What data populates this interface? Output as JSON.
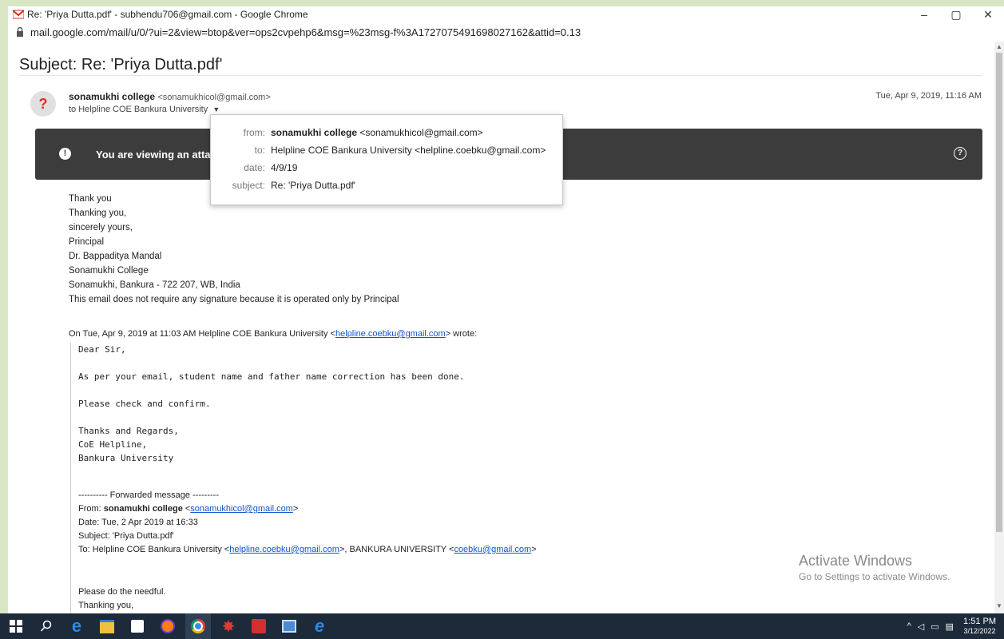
{
  "window": {
    "title": "Re: 'Priya Dutta.pdf' - subhendu706@gmail.com - Google Chrome",
    "controls": {
      "minimize": "–",
      "maximize": "▢",
      "close": "✕"
    }
  },
  "address": {
    "url": "mail.google.com/mail/u/0/?ui=2&view=btop&ver=ops2cvpehp6&msg=%23msg-f%3A1727075491698027162&attid=0.13"
  },
  "email": {
    "subject": "Subject: Re: 'Priya Dutta.pdf'",
    "sender_name": "sonamukhi college",
    "sender_email": "<sonamukhicol@gmail.com>",
    "to_line": "to Helpline COE Bankura University",
    "date": "Tue, Apr 9, 2019, 11:16 AM",
    "banner_text": "You are viewing an attac",
    "popup": {
      "from_label": "from:",
      "from_name": "sonamukhi college",
      "from_email": "<sonamukhicol@gmail.com>",
      "to_label": "to:",
      "to_value": "Helpline COE Bankura University <helpline.coebku@gmail.com>",
      "date_label": "date:",
      "date_value": "4/9/19",
      "subject_label": "subject:",
      "subject_value": "Re: 'Priya Dutta.pdf'"
    },
    "body_lines": [
      "Thank you",
      "Thanking you,",
      "sincerely yours,",
      "Principal",
      "Dr. Bappaditya Mandal",
      "Sonamukhi College",
      "Sonamukhi, Bankura - 722 207, WB, India",
      "This email does not require any signature because it is operated only by Principal"
    ],
    "quote_intro": "On Tue, Apr 9, 2019 at 11:03 AM Helpline COE Bankura University <",
    "quote_link": "helpline.coebku@gmail.com",
    "quote_outro": "> wrote:",
    "quoted": {
      "greeting": "Dear Sir,",
      "line1": "As per your email, student name and father name correction has been done.",
      "line2": "Please check and confirm.",
      "sign1": "Thanks and Regards,",
      "sign2": "CoE Helpline,",
      "sign3": "Bankura University"
    },
    "forwarded": {
      "header": "---------- Forwarded message ---------",
      "from_label": "From: ",
      "from_name": "sonamukhi college",
      "from_link": "sonamukhicol@gmail.com",
      "date_line": "Date: Tue, 2 Apr 2019 at 16:33",
      "subject_line": "Subject: 'Priya Dutta.pdf'",
      "to_prefix": "To: Helpline COE Bankura University <",
      "to_link1": "helpline.coebku@gmail.com",
      "to_mid": ">, BANKURA UNIVERSITY <",
      "to_link2": "coebku@gmail.com",
      "to_end": ">",
      "tail1": "Please do the needful.",
      "tail2": "Thanking you,"
    }
  },
  "watermark": {
    "line1": "Activate Windows",
    "line2": "Go to Settings to activate Windows."
  },
  "taskbar": {
    "time": "1:51 PM",
    "date": "3/12/2022"
  }
}
